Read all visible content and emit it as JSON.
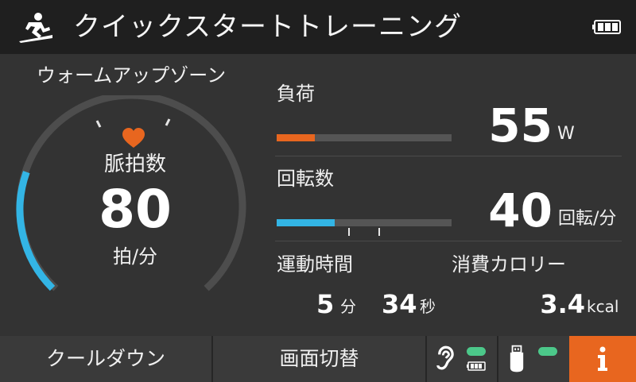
{
  "header": {
    "title": "クイックスタートトレーニング",
    "icon": "cycling-person-icon",
    "battery_icon": "battery-full-icon"
  },
  "heart_rate": {
    "zone_label": "ウォームアップゾーン",
    "label": "脈拍数",
    "value": "80",
    "unit": "拍/分",
    "icon": "heart-icon",
    "gauge_fill_fraction": 0.24
  },
  "load": {
    "label": "負荷",
    "value": "55",
    "unit": "W",
    "bar_fraction": 0.22
  },
  "rpm": {
    "label": "回転数",
    "value": "40",
    "unit": "回転/分",
    "bar_fraction": 0.33
  },
  "time": {
    "label": "運動時間",
    "minutes": "5",
    "minutes_unit": "分",
    "seconds": "34",
    "seconds_unit": "秒"
  },
  "calories": {
    "label": "消費カロリー",
    "value": "3.4",
    "unit": "kcal"
  },
  "footer": {
    "cooldown_label": "クールダウン",
    "switch_screen_label": "画面切替",
    "ear_sensor_icon": "ear-sensor-icon",
    "usb_icon": "usb-drive-icon",
    "info_icon": "info-icon"
  },
  "colors": {
    "accent_orange": "#e8661f",
    "accent_blue": "#33b5e5",
    "status_green": "#4cc88a",
    "background": "#333333",
    "header_bg": "#1f1f1f"
  }
}
